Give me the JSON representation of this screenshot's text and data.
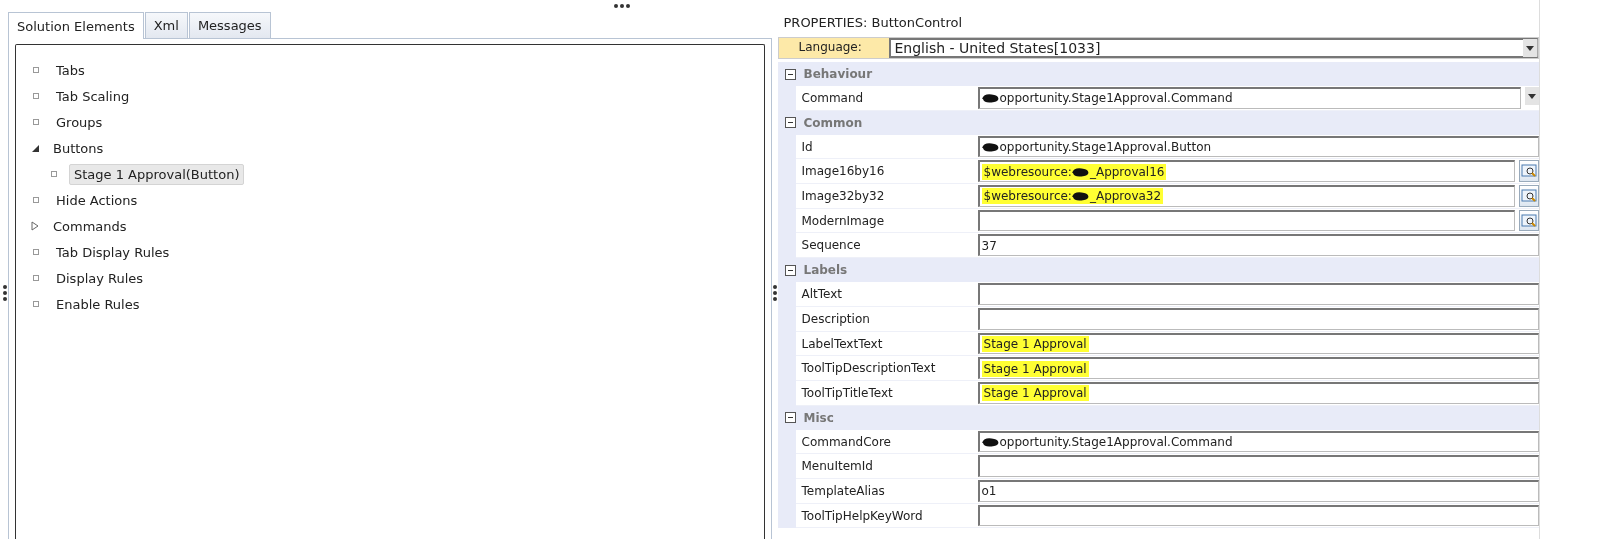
{
  "left_pane": {
    "tabs": [
      {
        "label": "Solution Elements",
        "selected": true
      },
      {
        "label": "Xml",
        "selected": false
      },
      {
        "label": "Messages",
        "selected": false
      }
    ],
    "tree": [
      {
        "label": "Tabs",
        "kind": "leaf"
      },
      {
        "label": "Tab Scaling",
        "kind": "leaf"
      },
      {
        "label": "Groups",
        "kind": "leaf"
      },
      {
        "label": "Buttons",
        "kind": "branch",
        "expanded": true,
        "children": [
          {
            "label": "Stage 1 Approval(Button)",
            "kind": "leaf",
            "selected": true
          }
        ]
      },
      {
        "label": "Hide Actions",
        "kind": "leaf"
      },
      {
        "label": "Commands",
        "kind": "branch",
        "expanded": false
      },
      {
        "label": "Tab Display Rules",
        "kind": "leaf"
      },
      {
        "label": "Display Rules",
        "kind": "leaf"
      },
      {
        "label": "Enable Rules",
        "kind": "leaf"
      }
    ]
  },
  "properties": {
    "title": "PROPERTIES: ButtonControl",
    "language": {
      "label": "Language:",
      "value": "English - United States[1033]"
    },
    "groups": [
      {
        "name": "Behaviour",
        "expanded": true,
        "rows": [
          {
            "label": "Command",
            "value": "opportunity.Stage1Approval.Command",
            "kind": "dropdown",
            "redacted": true,
            "highlighted": false
          }
        ]
      },
      {
        "name": "Common",
        "expanded": true,
        "rows": [
          {
            "label": "Id",
            "value": "opportunity.Stage1Approval.Button",
            "kind": "text",
            "redacted": true,
            "highlighted": false
          },
          {
            "label": "Image16by16",
            "value": "$webresource:",
            "value_after": "_Approval16",
            "kind": "browse",
            "redacted": true,
            "highlighted": true
          },
          {
            "label": "Image32by32",
            "value": "$webresource:",
            "value_after": "_Approva32",
            "kind": "browse",
            "redacted": true,
            "highlighted": true
          },
          {
            "label": "ModernImage",
            "kind": "browse",
            "redacted": false,
            "highlighted": false
          },
          {
            "label": "Sequence",
            "value": "37",
            "kind": "text",
            "redacted": false,
            "highlighted": false
          }
        ]
      },
      {
        "name": "Labels",
        "expanded": true,
        "rows": [
          {
            "label": "AltText",
            "kind": "text",
            "redacted": false,
            "highlighted": false
          },
          {
            "label": "Description",
            "kind": "text",
            "redacted": false,
            "highlighted": false
          },
          {
            "label": "LabelTextText",
            "value": "Stage 1 Approval",
            "kind": "text",
            "redacted": false,
            "highlighted": true
          },
          {
            "label": "ToolTipDescriptionText",
            "value": "Stage 1 Approval",
            "kind": "text",
            "redacted": false,
            "highlighted": true
          },
          {
            "label": "ToolTipTitleText",
            "value": "Stage 1 Approval",
            "kind": "text",
            "redacted": false,
            "highlighted": true
          }
        ]
      },
      {
        "name": "Misc",
        "expanded": true,
        "rows": [
          {
            "label": "CommandCore",
            "value": "opportunity.Stage1Approval.Command",
            "kind": "text",
            "redacted": true,
            "highlighted": false
          },
          {
            "label": "MenuItemId",
            "kind": "text",
            "redacted": false,
            "highlighted": false
          },
          {
            "label": "TemplateAlias",
            "value": "o1",
            "kind": "text",
            "redacted": false,
            "highlighted": false
          },
          {
            "label": "ToolTipHelpKeyWord",
            "kind": "text",
            "redacted": false,
            "highlighted": false
          }
        ]
      }
    ]
  }
}
